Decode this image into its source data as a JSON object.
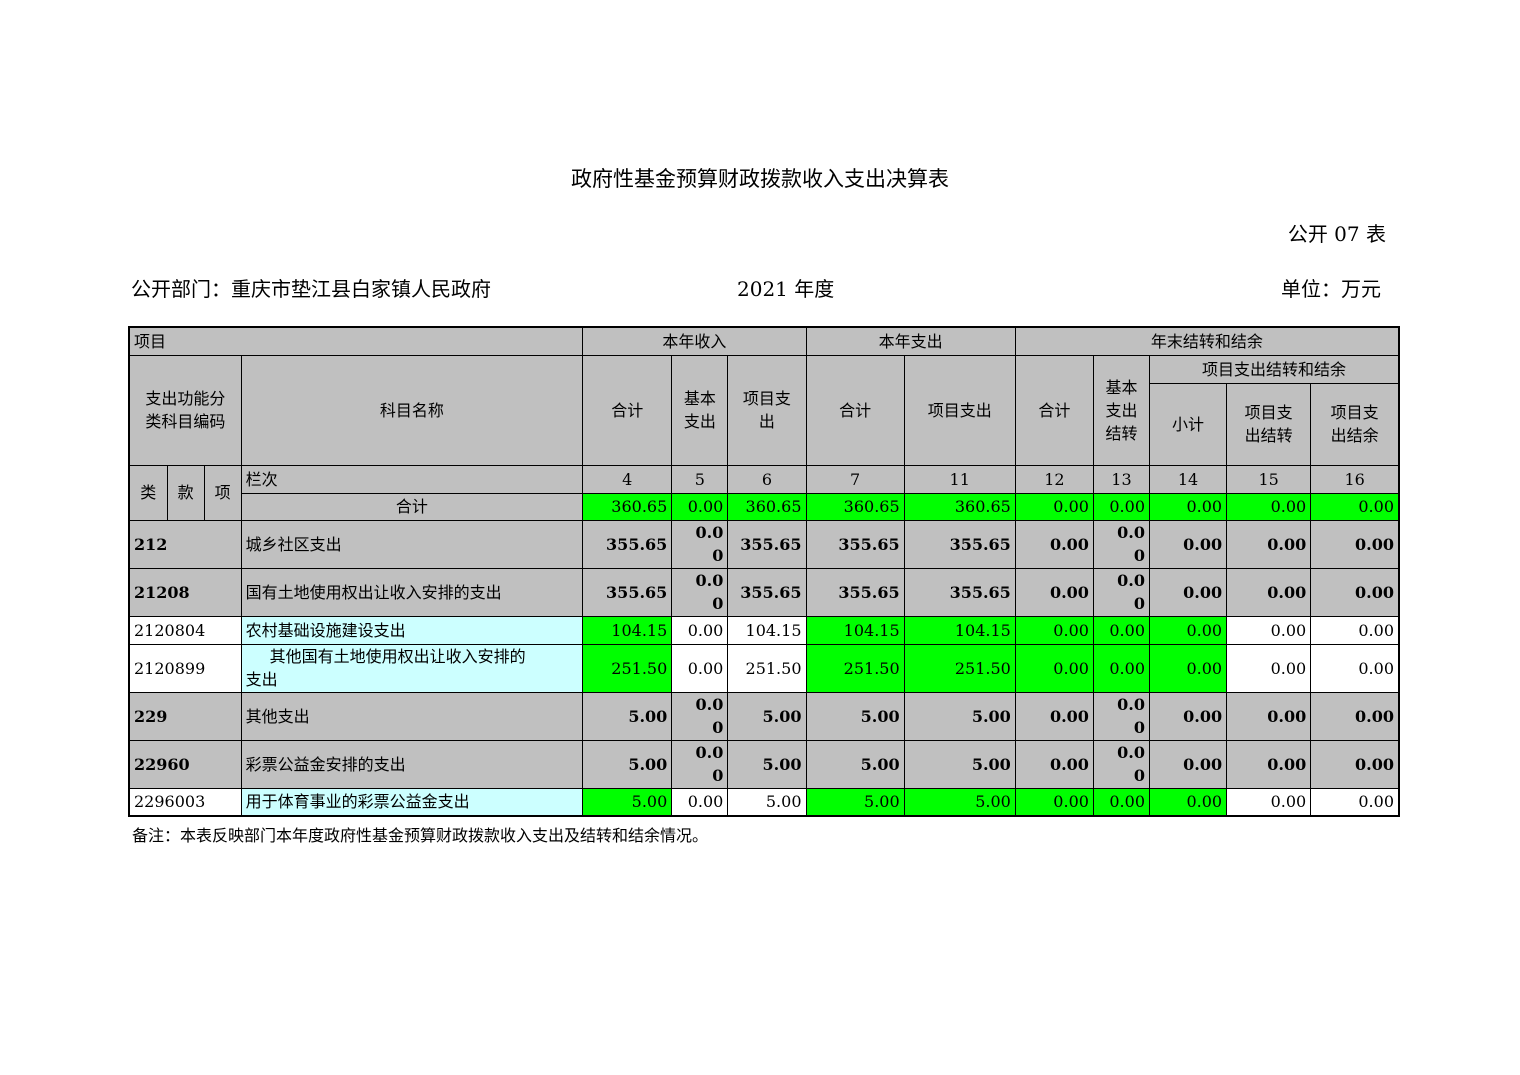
{
  "title": "政府性基金预算财政拨款收入支出决算表",
  "form_no": "公开 07 表",
  "dept_label": "公开部门：重庆市垫江县白家镇人民政府",
  "year_label": "2021 年度",
  "unit_label": "单位：万元",
  "header": {
    "item": "项目",
    "income": "本年收入",
    "expense": "本年支出",
    "year_end": "年末结转和结余",
    "project_carry": "项目支出结转和结余",
    "code_label": "支出功能分类科目编码",
    "name_label": "科目名称",
    "total": "合计",
    "basic_line1": "基本",
    "basic_line2": "支出",
    "proj_line1": "项目支",
    "proj_line2": "出",
    "proj_expense": "项目支出",
    "basic_carry_1": "基本",
    "basic_carry_2": "支出",
    "basic_carry_3": "结转",
    "subtotal": "小计",
    "proj_carry_1": "项目支",
    "proj_carry_2": "出结转",
    "proj_surplus_1": "项目支",
    "proj_surplus_2": "出结余",
    "lei": "类",
    "kuan": "款",
    "xiang": "项",
    "lanci": "栏次",
    "col_nums": [
      "4",
      "5",
      "6",
      "7",
      "11",
      "12",
      "13",
      "14",
      "15",
      "16"
    ]
  },
  "total_row": {
    "label": "合计",
    "values": [
      "360.65",
      "0.00",
      "360.65",
      "360.65",
      "360.65",
      "0.00",
      "0.00",
      "0.00",
      "0.00",
      "0.00"
    ]
  },
  "rows": [
    {
      "code": "212",
      "name": "城乡社区支出",
      "v4": "355.65",
      "v5a": "0.0",
      "v5b": "0",
      "v6": "355.65",
      "v7": "355.65",
      "v11": "355.65",
      "v12": "0.00",
      "v13a": "0.0",
      "v13b": "0",
      "v14": "0.00",
      "v15": "0.00",
      "v16": "0.00"
    },
    {
      "code": "21208",
      "name": "国有土地使用权出让收入安排的支出",
      "v4": "355.65",
      "v5a": "0.0",
      "v5b": "0",
      "v6": "355.65",
      "v7": "355.65",
      "v11": "355.65",
      "v12": "0.00",
      "v13a": "0.0",
      "v13b": "0",
      "v14": "0.00",
      "v15": "0.00",
      "v16": "0.00"
    },
    {
      "code": "2120804",
      "name": "农村基础设施建设支出",
      "v4": "104.15",
      "v5": "0.00",
      "v6": "104.15",
      "v7": "104.15",
      "v11": "104.15",
      "v12": "0.00",
      "v13": "0.00",
      "v14": "0.00",
      "v15": "0.00",
      "v16": "0.00"
    },
    {
      "code": "2120899",
      "name_line1": "其他国有土地使用权出让收入安排的",
      "name_line2": "支出",
      "v4": "251.50",
      "v5": "0.00",
      "v6": "251.50",
      "v7": "251.50",
      "v11": "251.50",
      "v12": "0.00",
      "v13": "0.00",
      "v14": "0.00",
      "v15": "0.00",
      "v16": "0.00"
    },
    {
      "code": "229",
      "name": "其他支出",
      "v4": "5.00",
      "v5a": "0.0",
      "v5b": "0",
      "v6": "5.00",
      "v7": "5.00",
      "v11": "5.00",
      "v12": "0.00",
      "v13a": "0.0",
      "v13b": "0",
      "v14": "0.00",
      "v15": "0.00",
      "v16": "0.00"
    },
    {
      "code": "22960",
      "name": "彩票公益金安排的支出",
      "v4": "5.00",
      "v5a": "0.0",
      "v5b": "0",
      "v6": "5.00",
      "v7": "5.00",
      "v11": "5.00",
      "v12": "0.00",
      "v13a": "0.0",
      "v13b": "0",
      "v14": "0.00",
      "v15": "0.00",
      "v16": "0.00"
    },
    {
      "code": "2296003",
      "name": "用于体育事业的彩票公益金支出",
      "v4": "5.00",
      "v5": "0.00",
      "v6": "5.00",
      "v7": "5.00",
      "v11": "5.00",
      "v12": "0.00",
      "v13": "0.00",
      "v14": "0.00",
      "v15": "0.00",
      "v16": "0.00"
    }
  ],
  "note": "备注：本表反映部门本年度政府性基金预算财政拨款收入支出及结转和结余情况。",
  "colors": {
    "header_gray": "#c0c0c0",
    "highlight_green": "#00ff00",
    "name_cyan": "#ccffff"
  }
}
